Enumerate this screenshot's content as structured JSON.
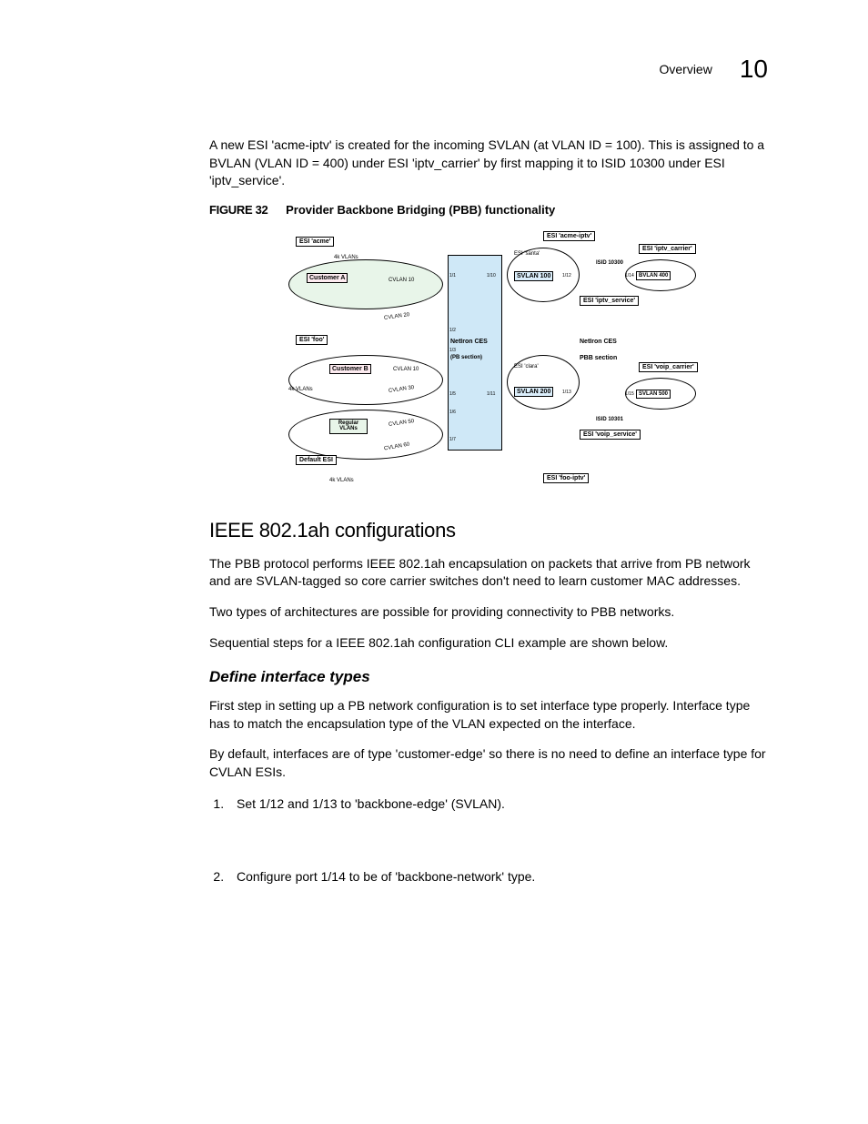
{
  "header": {
    "section": "Overview",
    "chapter_num": "10"
  },
  "intro_para": "A new ESI 'acme-iptv' is created for the incoming SVLAN (at VLAN ID = 100). This is assigned to a BVLAN (VLAN ID = 400) under ESI 'iptv_carrier' by first mapping it to ISID 10300 under ESI 'iptv_service'.",
  "figure": {
    "label": "FIGURE 32",
    "caption": "Provider Backbone Bridging (PBB) functionality"
  },
  "diagram": {
    "esi_acme": "ESI 'acme'",
    "esi_foo": "ESI 'foo'",
    "default_esi": "Default ESI",
    "esi_acme_iptv": "ESI 'acme-iptv'",
    "esi_iptv_carrier": "ESI 'iptv_carrier'",
    "esi_iptv_service": "ESI 'iptv_service'",
    "esi_voip_carrier": "ESI 'voip_carrier'",
    "esi_voip_service": "ESI 'voip_service'",
    "esi_foo_iptv": "ESI 'foo-iptv'",
    "esi_santa": "ESI 'santa'",
    "esi_clara": "ESI 'clara'",
    "customer_a": "Customer A",
    "customer_b": "Customer B",
    "regular_vlans": "Regular\nVLANs",
    "k4_a": "4k VLANs",
    "k4_b": "4k VLANs",
    "k4_c": "4k VLANs",
    "svlan_100": "SVLAN 100",
    "svlan_200": "SVLAN 200",
    "svlan_500": "SVLAN 500",
    "bvlan_400": "BVLAN 400",
    "isid_10300": "ISID 10300",
    "isid_10301": "ISID 10301",
    "netiron_ces_pb": "NetIron CES\n(PB section)",
    "netiron_ces_pbb": "NetIron CES\nPBB section",
    "cvlan10": "CVLAN 10",
    "cvlan20": "CVLAN 20",
    "cvlan10b": "CVLAN 10",
    "cvlan30": "CVLAN 30",
    "cvlan50": "CVLAN 50",
    "cvlan60": "CVLAN 60",
    "p11": "1/1",
    "p12": "1/2",
    "p13": "1/3",
    "p15": "1/5",
    "p16": "1/6",
    "p17": "1/7",
    "p110": "1/10",
    "p111": "1/11",
    "p112": "1/12",
    "p113": "1/13",
    "p114": "1/14",
    "p115": "1/15"
  },
  "section_heading": "IEEE 802.1ah configurations",
  "para1": "The PBB protocol performs IEEE 802.1ah encapsulation on packets that arrive from PB network and are SVLAN-tagged so core carrier switches don't need to learn customer MAC addresses.",
  "para2": "Two types of architectures are possible for providing connectivity to PBB networks.",
  "para3": "Sequential steps for a IEEE 802.1ah configuration CLI example are shown below.",
  "subheading": "Define interface types",
  "para4": "First step in setting up a PB network configuration is to set interface type properly. Interface type has to match the encapsulation type of the VLAN expected on the interface.",
  "para5": "By default, interfaces are of type 'customer-edge' so there is no need to define an interface type for CVLAN ESIs.",
  "steps": [
    "Set 1/12 and 1/13 to 'backbone-edge' (SVLAN).",
    "Configure port 1/14 to be of 'backbone-network' type."
  ]
}
